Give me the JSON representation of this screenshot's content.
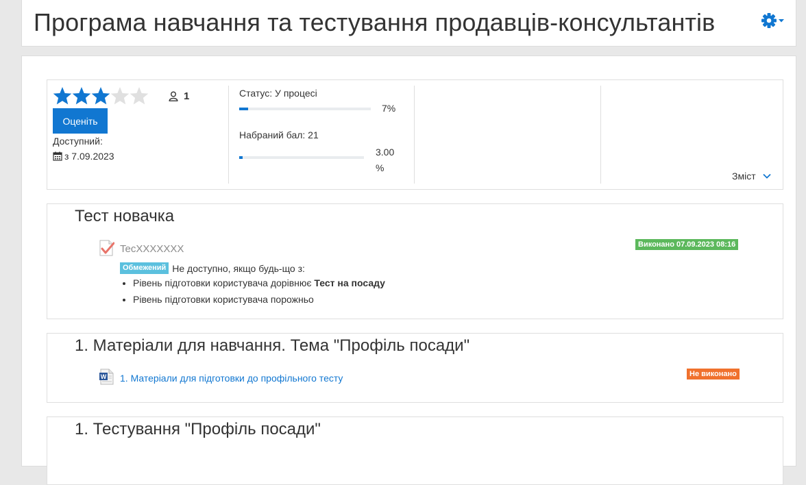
{
  "header": {
    "title": "Програма навчання та тестування продавців-консультантів",
    "settings_icon": "gear-icon",
    "accent_color": "#1177d1"
  },
  "info": {
    "rating": {
      "value": 3,
      "max": 5
    },
    "users_icon": "user-icon",
    "users_count": "1",
    "rate_button": "Оценіть",
    "available_label": "Доступний:",
    "available_icon": "calendar-icon",
    "available_date": "з 7.09.2023",
    "status_label": "Статус: У процесі",
    "status_progress": 7,
    "status_percent": "7%",
    "score_label": "Набраний бал: 21",
    "score_progress": 3,
    "score_percent_value": "3.00",
    "score_percent_sign": "%",
    "toc_label": "Зміст",
    "toc_icon": "chevron-down-icon"
  },
  "sections": [
    {
      "title": "Тест новачка",
      "activity": {
        "icon": "quiz-icon",
        "name": "TecXXXXXXX",
        "completion": "Виконано 07.09.2023 08:16",
        "completion_color": "#5cb85c"
      },
      "restriction": {
        "badge": "Обмежений",
        "text": "Не доступно, якщо будь-що з:",
        "conditions": [
          {
            "text": "Рівень підготовки користувача дорівнює ",
            "bold": "Тест на посаду"
          },
          {
            "text": "Рівень підготовки користувача порожньо",
            "bold": ""
          }
        ]
      }
    },
    {
      "title": "1. Матеріали для навчання. Тема \"Профіль посади\"",
      "activity": {
        "icon": "word-document-icon",
        "name": "1. Матеріали для підготовки до профільного тесту",
        "completion": "Не виконано",
        "completion_color": "#f0712d"
      }
    },
    {
      "title": "1. Тестування \"Профіль посади\""
    }
  ]
}
